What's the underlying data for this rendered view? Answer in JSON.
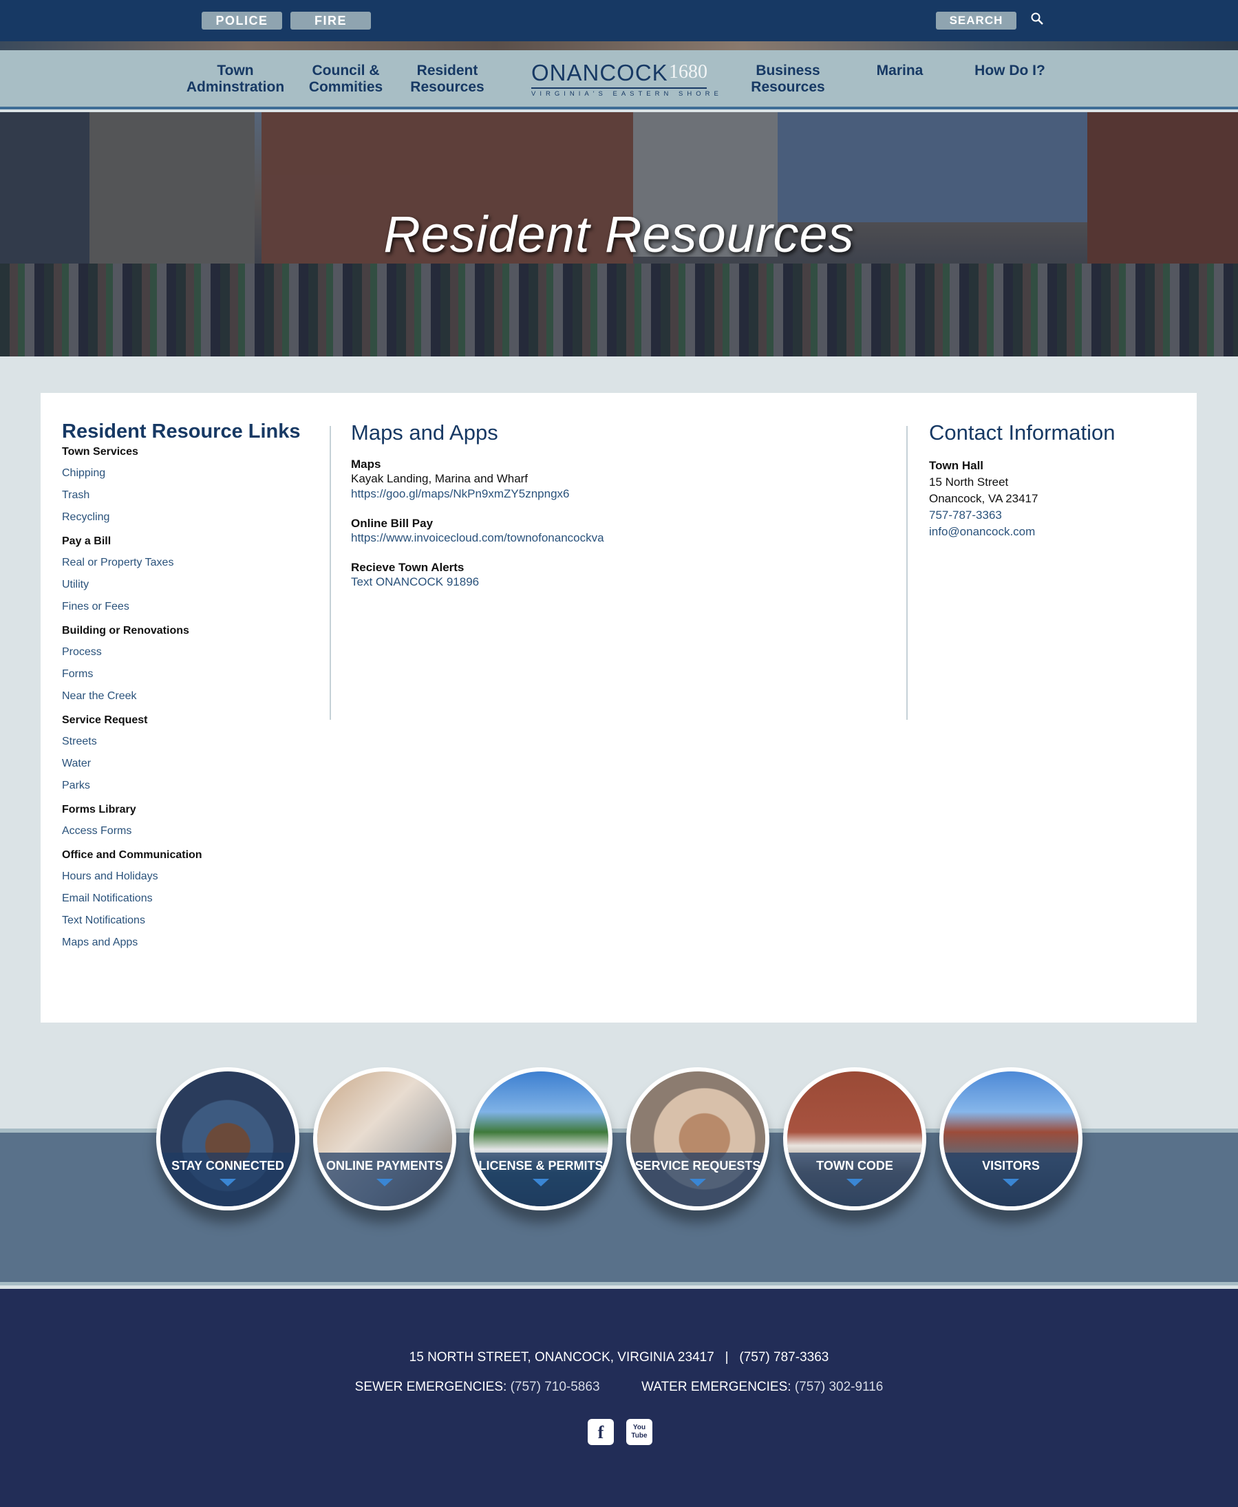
{
  "topbar": {
    "police_label": "POLICE",
    "fire_label": "FIRE",
    "search_label": "SEARCH"
  },
  "nav": {
    "items": [
      {
        "line1": "Town",
        "line2": "Adminstration"
      },
      {
        "line1": "Council &",
        "line2": "Commities"
      },
      {
        "line1": "Resident",
        "line2": "Resources"
      },
      {
        "line1": "Business",
        "line2": "Resources"
      },
      {
        "line1": "Marina",
        "line2": ""
      },
      {
        "line1": "How Do I?",
        "line2": ""
      }
    ],
    "logo": {
      "name": "ONANCOCK",
      "year": "1680",
      "tagline": "VIRGINIA'S EASTERN SHORE"
    }
  },
  "hero": {
    "title": "Resident Resources"
  },
  "links": {
    "heading": "Resident Resource Links",
    "sections": [
      {
        "title": "Town Services",
        "items": [
          "Chipping",
          "Trash",
          "Recycling"
        ]
      },
      {
        "title": "Pay a Bill",
        "items": [
          "Real or Property Taxes",
          "Utility",
          "Fines or Fees"
        ]
      },
      {
        "title": "Building or Renovations",
        "items": [
          "Process",
          "Forms",
          "Near the Creek"
        ]
      },
      {
        "title": "Service Request",
        "items": [
          "Streets",
          "Water",
          "Parks"
        ]
      },
      {
        "title": "Forms Library",
        "items": [
          "Access Forms"
        ]
      },
      {
        "title": "Office and Communication",
        "items": [
          "Hours and Holidays",
          "Email Notifications",
          "Text Notifications",
          "Maps and Apps"
        ]
      }
    ]
  },
  "maps": {
    "heading": "Maps and Apps",
    "maps_label": "Maps",
    "maps_text": "Kayak Landing, Marina and Wharf",
    "maps_url": "https://goo.gl/maps/NkPn9xmZY5znpngx6",
    "bill_label": "Online Bill Pay",
    "bill_url": "https://www.invoicecloud.com/townofonancockva",
    "alerts_label": "Recieve Town Alerts",
    "alerts_text": "Text ONANCOCK 91896"
  },
  "contact": {
    "heading": "Contact Information",
    "name": "Town Hall",
    "street": "15 North Street",
    "city": "Onancock, VA 23417",
    "phone": "757-787-3363",
    "email": "info@onancock.com"
  },
  "circles": [
    {
      "label": "STAY CONNECTED"
    },
    {
      "label": "ONLINE PAYMENTS"
    },
    {
      "label": "LICENSE & PERMITS"
    },
    {
      "label": "SERVICE REQUESTS"
    },
    {
      "label": "TOWN CODE"
    },
    {
      "label": "VISITORS"
    }
  ],
  "footer": {
    "address": "15 NORTH STREET, ONANCOCK, VIRGINIA 23417",
    "separator": "|",
    "phone": "(757) 787-3363",
    "sewer_label": "SEWER EMERGENCIES:",
    "sewer_phone": "(757) 710-5863",
    "water_label": "WATER EMERGENCIES:",
    "water_phone": "(757) 302-9116",
    "facebook_glyph": "f",
    "youtube_glyph": "You Tube"
  }
}
